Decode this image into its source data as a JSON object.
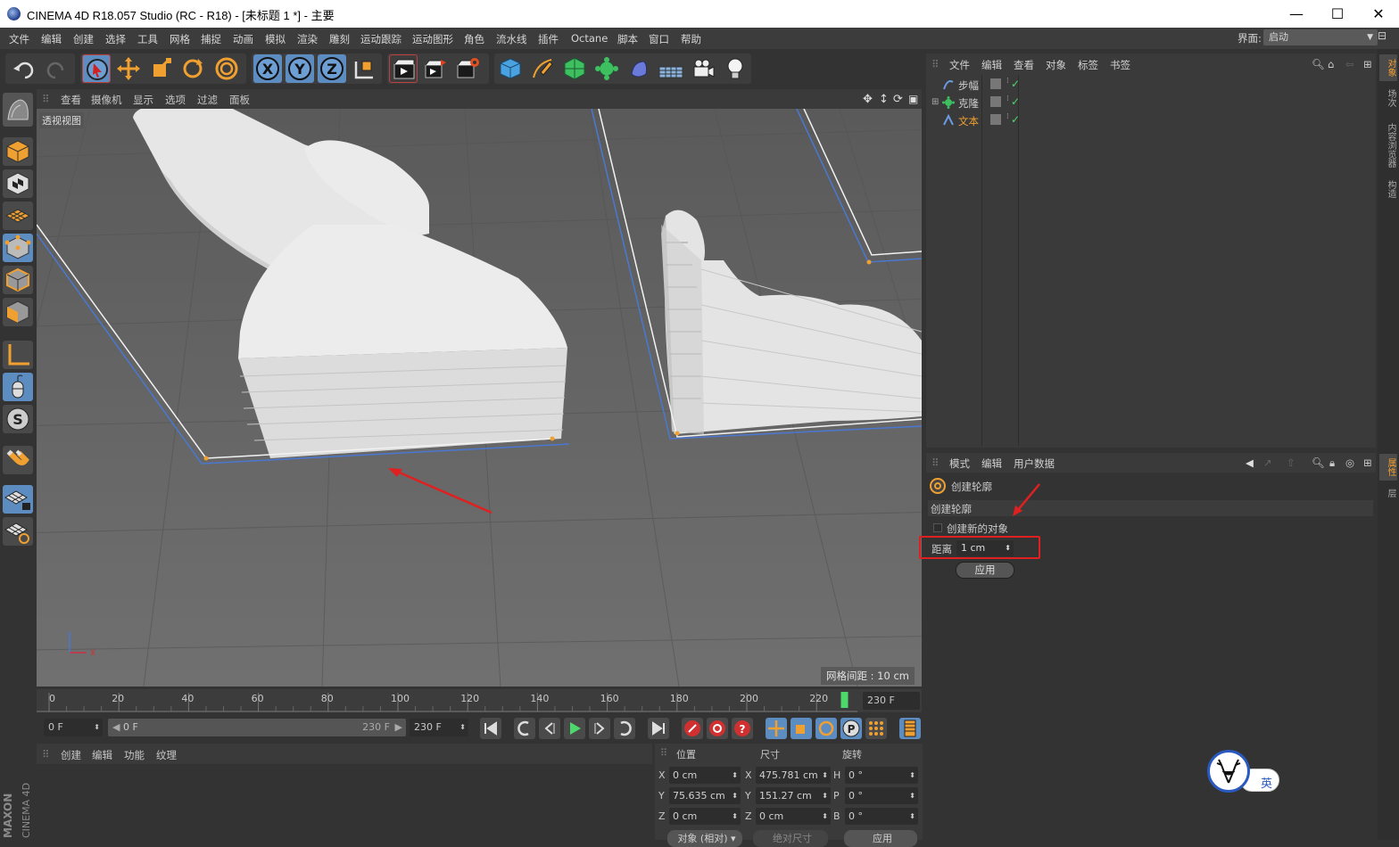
{
  "window": {
    "title": "CINEMA 4D R18.057 Studio (RC - R18) - [未标题 1 *] - 主要",
    "minimize": "—",
    "maximize": "☐",
    "close": "✕"
  },
  "menubar": {
    "items": [
      "文件",
      "编辑",
      "创建",
      "选择",
      "工具",
      "网格",
      "捕捉",
      "动画",
      "模拟",
      "渲染",
      "雕刻",
      "运动跟踪",
      "运动图形",
      "角色",
      "流水线",
      "插件",
      "Octane",
      "脚本",
      "窗口",
      "帮助"
    ],
    "layout_label": "界面:",
    "layout_value": "启动"
  },
  "viewport": {
    "menu": [
      "查看",
      "摄像机",
      "显示",
      "选项",
      "过滤",
      "面板"
    ],
    "label": "透视视图",
    "grid_info": "网格间距 : 10 cm",
    "axis_y": "Y",
    "axis_x": "X"
  },
  "timeline": {
    "ticks": [
      "0",
      "20",
      "40",
      "60",
      "80",
      "100",
      "120",
      "140",
      "160",
      "180",
      "200",
      "220"
    ],
    "end_frame": "230 F",
    "current_frame": "0 F",
    "range_start": "0 F",
    "range_end": "230 F",
    "range_field": "230 F",
    "playhead_fraction": 0.984
  },
  "materials": {
    "menu": [
      "创建",
      "编辑",
      "功能",
      "纹理"
    ]
  },
  "coordinates": {
    "headers": [
      "位置",
      "尺寸",
      "旋转"
    ],
    "rows": [
      {
        "axis": "X",
        "pos": "0 cm",
        "size_axis": "X",
        "size": "475.781 cm",
        "rot_axis": "H",
        "rot": "0 °"
      },
      {
        "axis": "Y",
        "pos": "75.635 cm",
        "size_axis": "Y",
        "size": "151.27 cm",
        "rot_axis": "P",
        "rot": "0 °"
      },
      {
        "axis": "Z",
        "pos": "0 cm",
        "size_axis": "Z",
        "size": "0 cm",
        "rot_axis": "B",
        "rot": "0 °"
      }
    ],
    "mode": "对象 (相对)",
    "size_mode": "绝对尺寸",
    "apply": "应用"
  },
  "object_manager": {
    "menu": [
      "文件",
      "编辑",
      "查看",
      "对象",
      "标签",
      "书签"
    ],
    "objects": [
      {
        "name": "步幅",
        "color": "#d0d0d0"
      },
      {
        "name": "克隆",
        "color": "#d0d0d0"
      },
      {
        "name": "文本",
        "color": "#f0a030"
      }
    ]
  },
  "attribute_manager": {
    "menu": [
      "模式",
      "编辑",
      "用户数据"
    ],
    "tool_title": "创建轮廓",
    "section": "创建轮廓",
    "checkbox_label": "创建新的对象",
    "distance_label": "距离",
    "distance_value": "1 cm",
    "apply": "应用"
  },
  "right_tabs": [
    "对象",
    "场次",
    "内容浏览器",
    "构造",
    "属性",
    "层"
  ],
  "ime": {
    "label": "英"
  },
  "brand": {
    "line1": "MAXON",
    "line2": "CINEMA 4D"
  },
  "colors": {
    "accent_orange": "#f0a030",
    "annotation_red": "#e02020",
    "selection_blue": "#5c8cc0"
  }
}
